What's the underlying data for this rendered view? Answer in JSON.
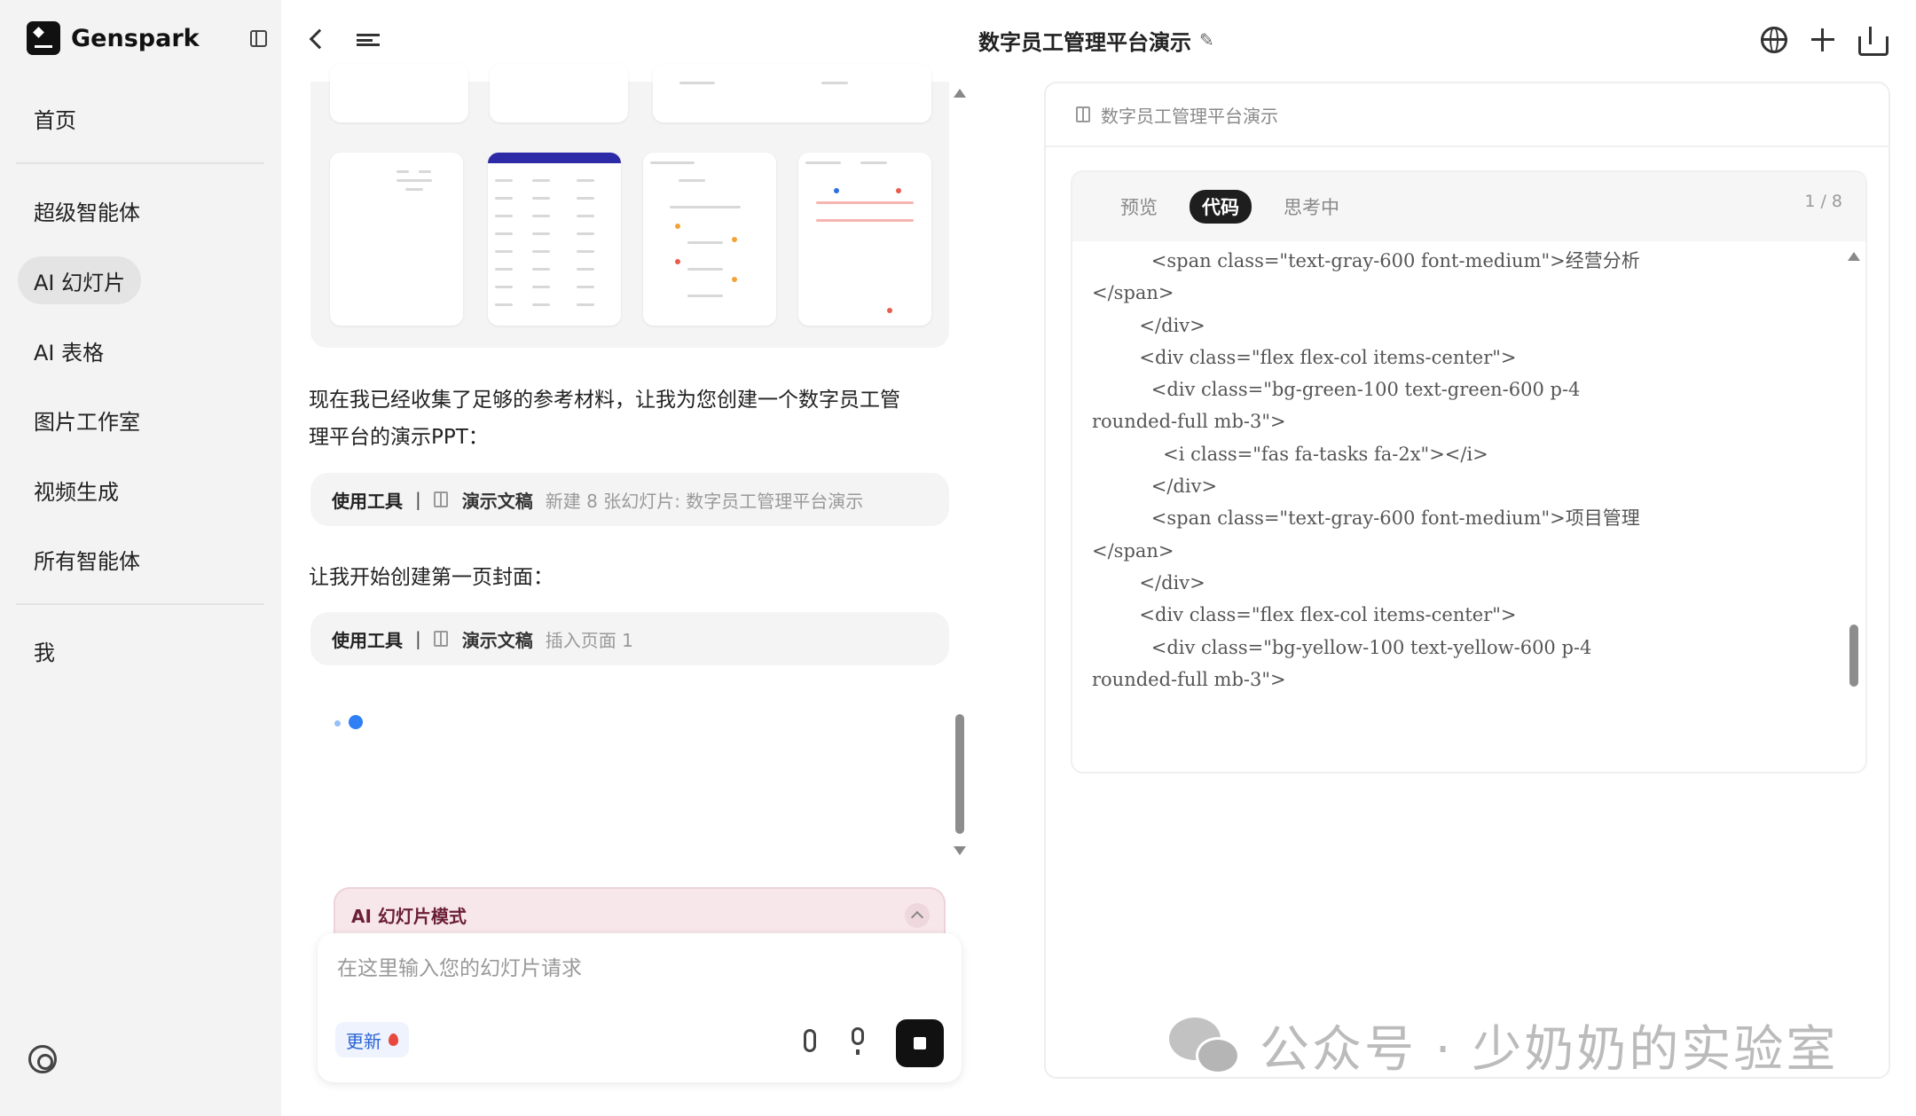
{
  "app": {
    "brand": "Genspark"
  },
  "sidebar": {
    "items": [
      {
        "label": "首页"
      },
      {
        "label": "超级智能体"
      },
      {
        "label": "AI 幻灯片"
      },
      {
        "label": "AI 表格"
      },
      {
        "label": "图片工作室"
      },
      {
        "label": "视频生成"
      },
      {
        "label": "所有智能体"
      },
      {
        "label": "我"
      }
    ],
    "active": "AI 幻灯片"
  },
  "header": {
    "title": "数字员工管理平台演示"
  },
  "chat": {
    "messages": [
      {
        "line1": "现在我已经收集了足够的参考材料，让我为您创建一个数字员工管",
        "line2": "理平台的演示PPT："
      },
      {
        "text": "让我开始创建第一页封面："
      }
    ],
    "tools": [
      {
        "label": "使用工具",
        "separator": "|",
        "name": "演示文稿",
        "desc": "新建 8 张幻灯片: 数字员工管理平台演示"
      },
      {
        "label": "使用工具",
        "separator": "|",
        "name": "演示文稿",
        "desc": "插入页面 1"
      }
    ]
  },
  "composer": {
    "mode_label": "AI 幻灯片模式",
    "placeholder": "在这里输入您的幻灯片请求",
    "update_label": "更新"
  },
  "panel": {
    "title": "数字员工管理平台演示",
    "tabs": [
      {
        "label": "预览"
      },
      {
        "label": "代码"
      },
      {
        "label": "思考中"
      }
    ],
    "active_tab": "代码",
    "page_count": "1 / 8",
    "code_lines": [
      "          <span class=\"text-gray-600 font-medium\">经营分析",
      "</span>",
      "        </div>",
      "        <div class=\"flex flex-col items-center\">",
      "          <div class=\"bg-green-100 text-green-600 p-4",
      "rounded-full mb-3\">",
      "            <i class=\"fas fa-tasks fa-2x\"></i>",
      "          </div>",
      "          <span class=\"text-gray-600 font-medium\">项目管理",
      "</span>",
      "        </div>",
      "        <div class=\"flex flex-col items-center\">",
      "          <div class=\"bg-yellow-100 text-yellow-600 p-4",
      "rounded-full mb-3\">"
    ]
  },
  "watermark": {
    "text": "公众号 · 少奶奶的实验室"
  }
}
